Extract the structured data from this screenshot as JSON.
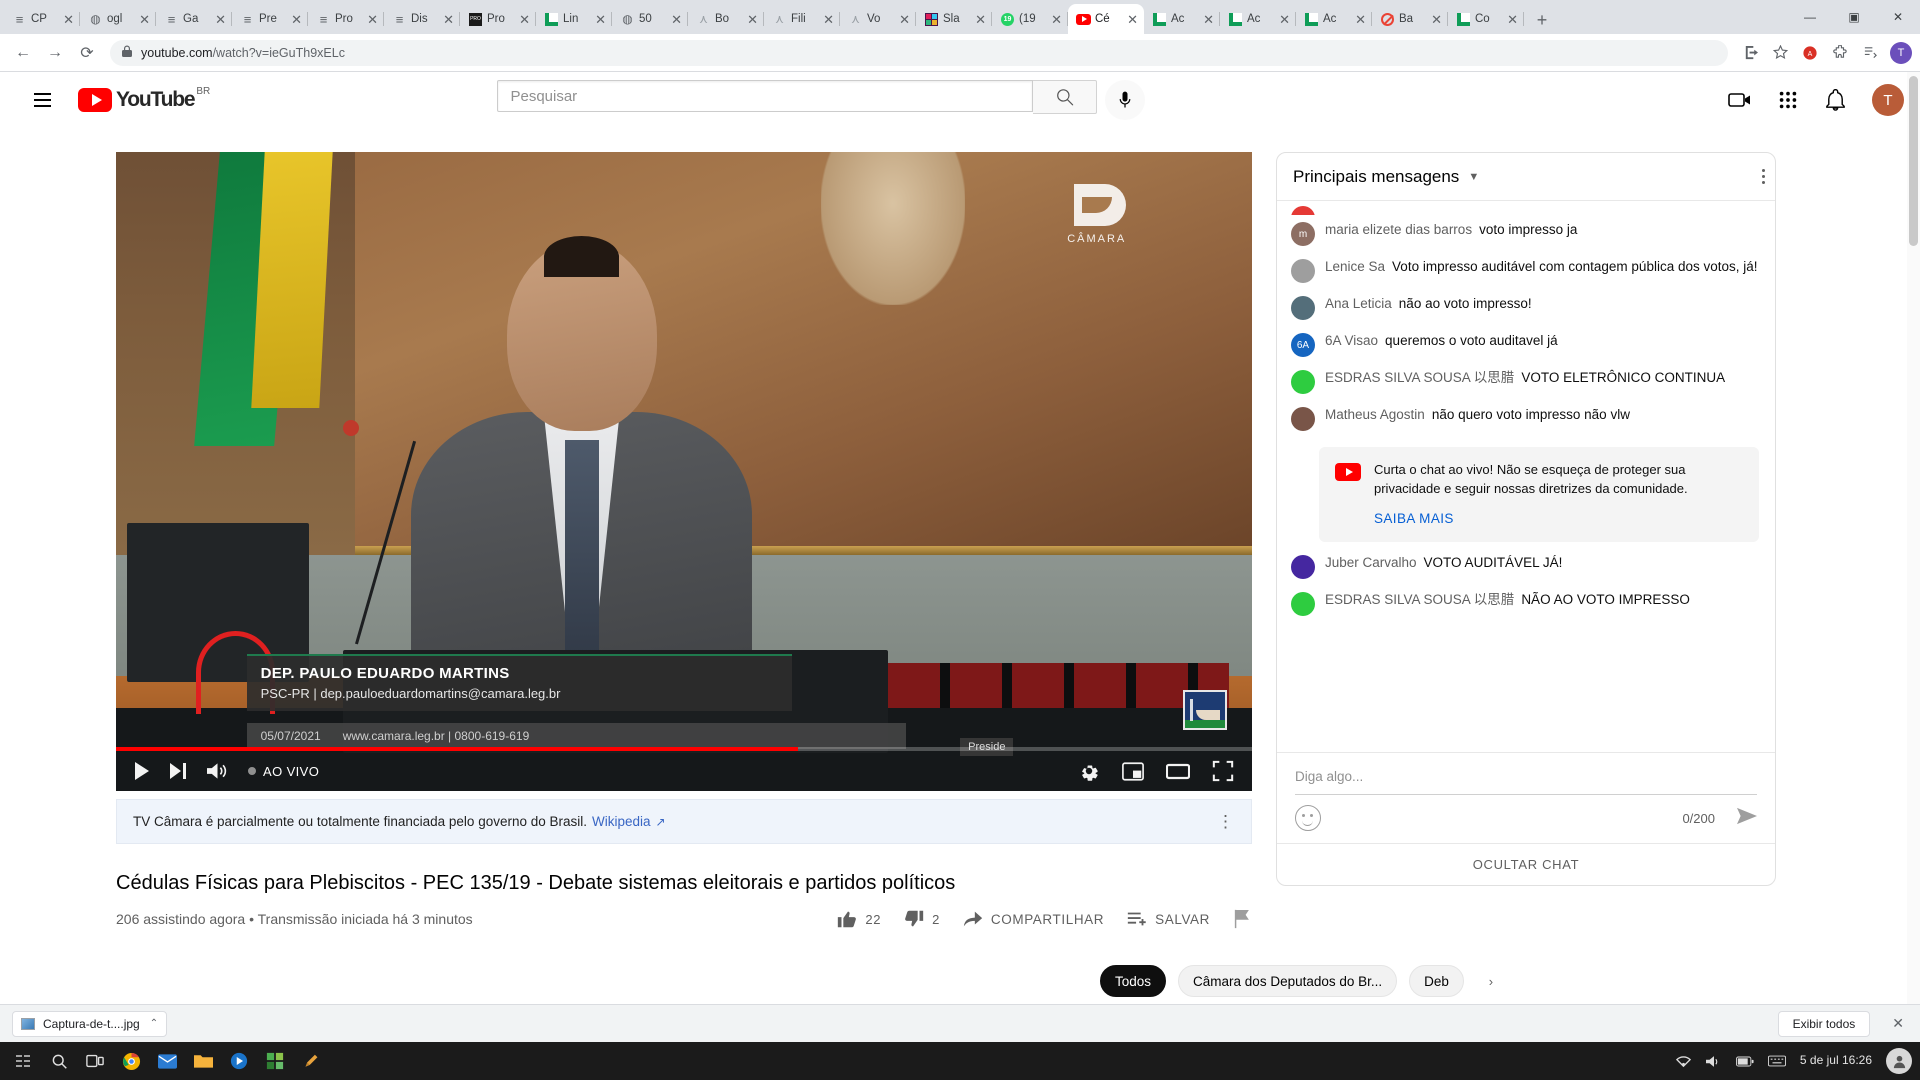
{
  "browser": {
    "tabs": [
      {
        "label": "CP",
        "icon": "document-icon",
        "active": false
      },
      {
        "label": "ogl",
        "icon": "globe-icon",
        "active": false
      },
      {
        "label": "Ga",
        "icon": "document-icon",
        "active": false
      },
      {
        "label": "Pre",
        "icon": "document-icon",
        "active": false
      },
      {
        "label": "Pro",
        "icon": "document-icon",
        "active": false
      },
      {
        "label": "Dis",
        "icon": "document-icon",
        "active": false
      },
      {
        "label": "Pro",
        "icon": "black-square-icon",
        "active": false
      },
      {
        "label": "Lin",
        "icon": "green-chart-icon",
        "active": false
      },
      {
        "label": "50",
        "icon": "globe-icon",
        "active": false
      },
      {
        "label": "Bo",
        "icon": "spark-icon",
        "active": false
      },
      {
        "label": "Fili",
        "icon": "spark-icon",
        "active": false
      },
      {
        "label": "Vo",
        "icon": "spark-icon",
        "active": false
      },
      {
        "label": "Sla",
        "icon": "slack-icon",
        "active": false
      },
      {
        "label": "(19",
        "icon": "whatsapp-icon",
        "active": false
      },
      {
        "label": "Cé",
        "icon": "youtube-icon",
        "active": true
      },
      {
        "label": "Ac",
        "icon": "green-chart-icon",
        "active": false
      },
      {
        "label": "Ac",
        "icon": "green-chart-icon",
        "active": false
      },
      {
        "label": "Ac",
        "icon": "green-chart-icon",
        "active": false
      },
      {
        "label": "Ba",
        "icon": "blocked-icon",
        "active": false
      },
      {
        "label": "Co",
        "icon": "green-chart-icon",
        "active": false
      }
    ],
    "new_tab_label": "+",
    "window_controls": {
      "minimize": "—",
      "maximize": "▣",
      "close": "✕"
    },
    "nav": {
      "back": "←",
      "forward": "→",
      "reload": "⟳"
    },
    "url": {
      "lock": "🔒",
      "domain": "youtube.com",
      "path": "/watch?v=ieGuTh9xELc"
    },
    "toolbar_icons": [
      "share-icon",
      "bookmark-star-icon",
      "extension-blocker-icon",
      "puzzle-extensions-icon",
      "reading-list-icon"
    ],
    "profile_initial": "T"
  },
  "youtube": {
    "logo_text": "YouTube",
    "logo_country": "BR",
    "search": {
      "placeholder": "Pesquisar",
      "value": ""
    },
    "header_icons": [
      "create-video-icon",
      "apps-grid-icon",
      "notifications-bell-icon"
    ],
    "account_initial": "T"
  },
  "player": {
    "lower_third": {
      "name": "DEP. PAULO EDUARDO MARTINS",
      "subtitle": "PSC-PR | dep.pauloeduardomartins@camara.leg.br"
    },
    "ticker": {
      "date": "05/07/2021",
      "site": "www.camara.leg.br | 0800-619-619"
    },
    "presiding_chip": "Preside",
    "overlay_logo": "CÂMARA",
    "controls": {
      "play": "play-icon",
      "next": "next-icon",
      "volume": "volume-icon",
      "live_label": "AO VIVO",
      "settings": "settings-gear-icon",
      "miniplayer": "miniplayer-icon",
      "theater": "theater-mode-icon",
      "fullscreen": "fullscreen-icon"
    },
    "progress_percent": 60
  },
  "info_notice": {
    "text": "TV Câmara é parcialmente ou totalmente financiada pelo governo do Brasil.",
    "link": "Wikipedia",
    "external_icon": "↗"
  },
  "video": {
    "title": "Cédulas Físicas para Plebiscitos - PEC 135/19 - Debate sistemas eleitorais e partidos políticos",
    "stats": "206 assistindo agora • Transmissão iniciada há 3 minutos",
    "likes": "22",
    "dislikes": "2",
    "share_label": "COMPARTILHAR",
    "save_label": "SALVAR",
    "report_label": "report-flag-icon"
  },
  "chat": {
    "title": "Principais mensagens",
    "messages": [
      {
        "author": "maria elizete dias barros",
        "text": "voto impresso ja",
        "avatar_color": "#8d6e63",
        "avatar_initial": "m"
      },
      {
        "author": "Lenice Sa",
        "text": "Voto impresso auditável com contagem pública dos votos, já!",
        "avatar_color": "#9e9e9e",
        "avatar_initial": ""
      },
      {
        "author": "Ana Leticia",
        "text": "não ao voto impresso!",
        "avatar_color": "#546e7a",
        "avatar_initial": ""
      },
      {
        "author": "6A Visao",
        "text": "queremos o voto auditavel já",
        "avatar_color": "#1565c0",
        "avatar_initial": "6A"
      },
      {
        "author": "ESDRAS SILVA SOUSA 以思腊",
        "text": "VOTO ELETRÔNICO CONTINUA",
        "avatar_color": "#2ecc40",
        "avatar_initial": ""
      },
      {
        "author": "Matheus Agostin",
        "text": "não quero voto impresso não vlw",
        "avatar_color": "#795548",
        "avatar_initial": ""
      }
    ],
    "notice": {
      "text": "Curta o chat ao vivo! Não se esqueça de proteger sua privacidade e seguir nossas diretrizes da comunidade.",
      "cta": "SAIBA MAIS"
    },
    "messages_after": [
      {
        "author": "Juber Carvalho",
        "text": "VOTO AUDITÁVEL JÁ!",
        "avatar_color": "#4527a0",
        "avatar_initial": ""
      },
      {
        "author": "ESDRAS SILVA SOUSA 以思腊",
        "text": "NÃO AO VOTO IMPRESSO",
        "avatar_color": "#2ecc40",
        "avatar_initial": ""
      }
    ],
    "input_placeholder": "Diga algo...",
    "char_count": "0/200",
    "emoji_icon": "emoji-smiley-icon",
    "send_icon": "send-arrow-icon",
    "hide_chat_label": "OCULTAR CHAT"
  },
  "chips": [
    {
      "label": "Todos",
      "selected": true
    },
    {
      "label": "Câmara dos Deputados do Br...",
      "selected": false
    },
    {
      "label": "Deb",
      "selected": false
    }
  ],
  "chips_next_icon": "›",
  "download_bar": {
    "file_name": "Captura-de-t....jpg",
    "caret": "⌃",
    "show_all": "Exibir todos",
    "close": "✕"
  },
  "taskbar": {
    "start_icon": "start-icon",
    "apps": [
      "search-icon",
      "task-view-icon",
      "chrome-icon",
      "mail-icon",
      "folder-icon",
      "media-player-icon",
      "settings-icon",
      "notes-icon"
    ],
    "tray_icons": [
      "wifi-icon",
      "volume-icon",
      "battery-icon",
      "keyboard-icon"
    ],
    "clock_date": "5 de jul",
    "clock_time": "16:26",
    "person_icon": "person-icon"
  }
}
